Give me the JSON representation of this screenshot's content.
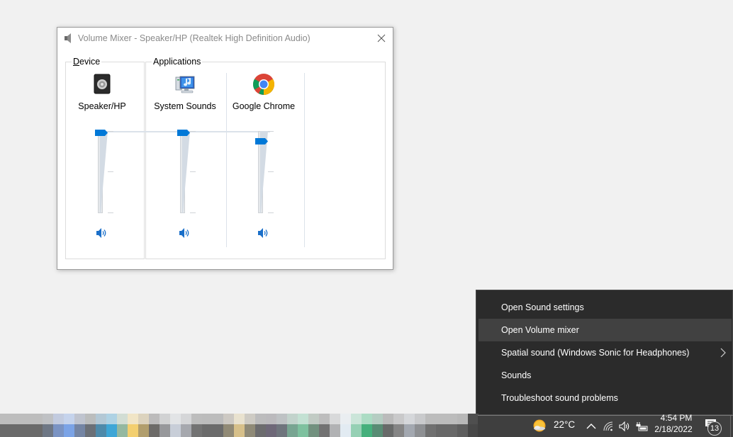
{
  "mixer": {
    "title": "Volume Mixer - Speaker/HP (Realtek High Definition Audio)",
    "device_group_label": "Device",
    "device_group_label_accel": "D",
    "device_group_label_rest": "evice",
    "apps_group_label": "Applications",
    "channels": [
      {
        "name": "Speaker/HP",
        "icon": "speaker-device-icon",
        "volume_percent": 100,
        "muted": false
      },
      {
        "name": "System Sounds",
        "icon": "system-sounds-icon",
        "volume_percent": 100,
        "muted": false
      },
      {
        "name": "Google Chrome",
        "icon": "chrome-icon",
        "volume_percent": 90,
        "muted": false
      }
    ],
    "accent_color": "#0078d7"
  },
  "context_menu": {
    "items": [
      {
        "label": "Open Sound settings",
        "highlighted": false,
        "has_submenu": false
      },
      {
        "label": "Open Volume mixer",
        "highlighted": true,
        "has_submenu": false
      },
      {
        "label": "Spatial sound (Windows Sonic for Headphones)",
        "highlighted": false,
        "has_submenu": true
      },
      {
        "label": "Sounds",
        "highlighted": false,
        "has_submenu": false
      },
      {
        "label": "Troubleshoot sound problems",
        "highlighted": false,
        "has_submenu": false
      }
    ]
  },
  "taskbar": {
    "weather_icon": "partly-sunny-icon",
    "temperature": "22°C",
    "clock_time": "4:54 PM",
    "clock_date": "2/18/2022",
    "notification_count": "13",
    "tray_icons": [
      "chevron-up-icon",
      "network-icon",
      "volume-icon",
      "battery-icon"
    ],
    "blurred_region_colors": {
      "row1": [
        "#bdbdbd",
        "#bdbdbd",
        "#bdbdbd",
        "#bdbdbd",
        "#bdbdbd",
        "#bdbdbd",
        "#bdbdbd",
        "#bdbdbd",
        "#bfc1c4",
        "#bfc1c4",
        "#c2cbdf",
        "#c2cbdf",
        "#c5d3ec",
        "#c5d3ec",
        "#bfc4cf",
        "#bfc4cf",
        "#bbbdbd",
        "#bbbdbd",
        "#b3c8d5",
        "#b3c8d5",
        "#aed2e4",
        "#aed2e4",
        "#d2ddd4",
        "#d2ddd4",
        "#f1e5c6",
        "#f1e5c6",
        "#dcd3be",
        "#dcd3be",
        "#bcbbbb",
        "#bcbbbb",
        "#d1d2d3",
        "#d1d2d3",
        "#e2e4e6",
        "#e2e4e6",
        "#d5d6d8",
        "#d5d6d8",
        "#bdbdbd",
        "#bdbdbd",
        "#bcbcbc",
        "#bcbcbc",
        "#bcbcbc",
        "#bcbcbc",
        "#cdc9c3",
        "#cdc9c3",
        "#e9e2cf",
        "#e9e2cf",
        "#cecbc4",
        "#cecbc4",
        "#bcbcbd",
        "#bcbcbd",
        "#bbbabd",
        "#bbbabd",
        "#bec2c4",
        "#bec2c4",
        "#c2d3cc",
        "#c2d3cc",
        "#c3e1d3",
        "#c3e1d3",
        "#c1cbc4",
        "#c1cbc4",
        "#bdbdbd",
        "#bdbdbd",
        "#d8d9da",
        "#d8d9da",
        "#eaeef1",
        "#eaeef1",
        "#cbe5d9",
        "#cbe5d9",
        "#acdcc4",
        "#acdcc4",
        "#b5cdc2",
        "#b5cdc2",
        "#bbbbbb",
        "#bbbbbb",
        "#c9c9ca",
        "#c9c9ca",
        "#d5d7da",
        "#d5d7da",
        "#c9cacc",
        "#c9cacc",
        "#bcbcbc",
        "#bcbcbc",
        "#bcbcbc",
        "#bcbcbc",
        "#bcbcbc",
        "#bcbcbc",
        "#b8b8b8",
        "#b8b8b8",
        "#4f4f4f",
        "#4f4f4f"
      ],
      "row2": [
        "#6a6a6a",
        "#6a6a6a",
        "#6a6a6a",
        "#6a6a6a",
        "#6a6a6a",
        "#6a6a6a",
        "#6a6a6a",
        "#6a6a6a",
        "#6e7785",
        "#6e7785",
        "#7a93c3",
        "#7a93c3",
        "#7ba3e6",
        "#7ba3e6",
        "#7485a4",
        "#7485a4",
        "#6b7077",
        "#6b7077",
        "#4e8aaa",
        "#4e8aaa",
        "#3ea6d6",
        "#3ea6d6",
        "#94b8a0",
        "#94b8a0",
        "#f3cf6f",
        "#f3cf6f",
        "#b19e6d",
        "#b19e6d",
        "#6d6b68",
        "#6d6b68",
        "#97989b",
        "#97989b",
        "#c8ced8",
        "#c8ced8",
        "#a6a8ae",
        "#a6a8ae",
        "#737373",
        "#737373",
        "#6b6b6b",
        "#6b6b6b",
        "#6b6b6b",
        "#6b6b6b",
        "#918a76",
        "#918a76",
        "#d7c08a",
        "#d7c08a",
        "#8f8a77",
        "#8f8a77",
        "#6c6c6e",
        "#6c6c6e",
        "#6e6878",
        "#6e6878",
        "#6f757d",
        "#6f757d",
        "#78a592",
        "#78a592",
        "#7ec19f",
        "#7ec19f",
        "#72917f",
        "#72917f",
        "#727272",
        "#727272",
        "#b1b2b4",
        "#b1b2b4",
        "#e2ebf2",
        "#e2ebf2",
        "#95d0b4",
        "#95d0b4",
        "#45b07c",
        "#45b07c",
        "#588c74",
        "#588c74",
        "#686a69",
        "#686a69",
        "#858585",
        "#858585",
        "#a3a8b0",
        "#a3a8b0",
        "#8e9093",
        "#8e9093",
        "#707070",
        "#707070",
        "#686868",
        "#686868",
        "#686868",
        "#686868",
        "#5e5e5e",
        "#5e5e5e",
        "#474747",
        "#474747"
      ]
    }
  }
}
